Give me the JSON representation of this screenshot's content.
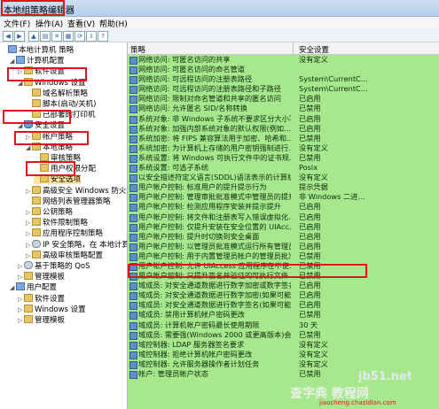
{
  "window": {
    "title": "本地组策略编辑器"
  },
  "menu": [
    "文件(F)",
    "操作(A)",
    "查看(V)",
    "帮助(H)"
  ],
  "tree": [
    {
      "label": "本地计算机 策略",
      "indent": 0,
      "icon": "pc"
    },
    {
      "label": "计算机配置",
      "indent": 1,
      "icon": "pc",
      "tw": "◢"
    },
    {
      "label": "软件设置",
      "indent": 2,
      "icon": "folder",
      "tw": "▷"
    },
    {
      "label": "Windows 设置",
      "indent": 2,
      "icon": "folder",
      "tw": "◢"
    },
    {
      "label": "域名解析策略",
      "indent": 3,
      "icon": "folder"
    },
    {
      "label": "脚本(启动/关机)",
      "indent": 3,
      "icon": "folder"
    },
    {
      "label": "已部署的打印机",
      "indent": 3,
      "icon": "folder"
    },
    {
      "label": "安全设置",
      "indent": 2,
      "icon": "shield",
      "tw": "◢"
    },
    {
      "label": "帐户策略",
      "indent": 3,
      "icon": "folder",
      "tw": "▷"
    },
    {
      "label": "本地策略",
      "indent": 3,
      "icon": "folder",
      "tw": "◢"
    },
    {
      "label": "审核策略",
      "indent": 4,
      "icon": "folder"
    },
    {
      "label": "用户权限分配",
      "indent": 4,
      "icon": "folder"
    },
    {
      "label": "安全选项",
      "indent": 4,
      "icon": "folder",
      "selected": true
    },
    {
      "label": "高级安全 Windows 防火墙",
      "indent": 3,
      "icon": "folder",
      "tw": "▷"
    },
    {
      "label": "网络列表管理器策略",
      "indent": 3,
      "icon": "folder"
    },
    {
      "label": "公钥策略",
      "indent": 3,
      "icon": "folder",
      "tw": "▷"
    },
    {
      "label": "软件限制策略",
      "indent": 3,
      "icon": "folder",
      "tw": "▷"
    },
    {
      "label": "应用程序控制策略",
      "indent": 3,
      "icon": "folder",
      "tw": "▷"
    },
    {
      "label": "IP 安全策略，在 本地计算机",
      "indent": 3,
      "icon": "gear",
      "tw": "▷"
    },
    {
      "label": "高级审核策略配置",
      "indent": 3,
      "icon": "folder",
      "tw": "▷"
    },
    {
      "label": "基于策略的 QoS",
      "indent": 2,
      "icon": "gear",
      "tw": "▷"
    },
    {
      "label": "管理模板",
      "indent": 2,
      "icon": "folder",
      "tw": "▷"
    },
    {
      "label": "用户配置",
      "indent": 1,
      "icon": "pc",
      "tw": "◢"
    },
    {
      "label": "软件设置",
      "indent": 2,
      "icon": "folder",
      "tw": "▷"
    },
    {
      "label": "Windows 设置",
      "indent": 2,
      "icon": "folder",
      "tw": "▷"
    },
    {
      "label": "管理模板",
      "indent": 2,
      "icon": "folder",
      "tw": "▷"
    }
  ],
  "columns": {
    "policy": "策略",
    "setting": "安全设置"
  },
  "policies": [
    {
      "name": "网络访问: 可匿名访问的共享",
      "value": "没有定义"
    },
    {
      "name": "网络访问: 可匿名访问的命名管道",
      "value": ""
    },
    {
      "name": "网络访问: 可远程访问的注册表路径",
      "value": "System\\CurrentC..."
    },
    {
      "name": "网络访问: 可远程访问的注册表路径和子路径",
      "value": "System\\CurrentC..."
    },
    {
      "name": "网络访问: 限制对命名管道和共享的匿名访问",
      "value": "已启用"
    },
    {
      "name": "网络访问: 允许匿名 SID/名称转换",
      "value": "已禁用"
    },
    {
      "name": "系统对象: 非 Windows 子系统不要求区分大小写",
      "value": "已启用"
    },
    {
      "name": "系统对象: 加强内部系统对象的默认权限(例如...)",
      "value": "已启用"
    },
    {
      "name": "系统加密: 将 FIPS 兼容算法用于加密、哈希和...",
      "value": "已禁用"
    },
    {
      "name": "系统加密: 为计算机上存储的用户密钥强制进行...",
      "value": "没有定义"
    },
    {
      "name": "系统设置: 将 Windows 可执行文件中的证书规...",
      "value": "已禁用"
    },
    {
      "name": "系统设置: 可选子系统",
      "value": "Posix"
    },
    {
      "name": "以安全描述符定义语言(SDDL)语法表示的计算机...",
      "value": "没有定义"
    },
    {
      "name": "用户帐户控制: 标准用户的提升提示行为",
      "value": "提示凭据"
    },
    {
      "name": "用户帐户控制: 管理审批批准模式中管理员的提升...",
      "value": "非 Windows 二进..."
    },
    {
      "name": "用户帐户控制: 检测应用程序安装并提示提升",
      "value": "已启用"
    },
    {
      "name": "用户帐户控制: 将文件和注册表写入错误虚拟化...",
      "value": "已启用"
    },
    {
      "name": "用户帐户控制: 仅提升安装在安全位置的 UIAcc...",
      "value": "已启用"
    },
    {
      "name": "用户帐户控制: 提升时切换到安全桌面",
      "value": "已启用"
    },
    {
      "name": "用户帐户控制: 以管理员批准模式运行所有管理员",
      "value": "已启用"
    },
    {
      "name": "用户帐户控制: 用于内置管理员帐户的管理员批准...",
      "value": "已禁用"
    },
    {
      "name": "用户帐户控制: 允许 UIAccess 应用程序在不使...",
      "value": "已禁用"
    },
    {
      "name": "用户帐户控制: 只提升签名并验证的可执行文件",
      "value": "已禁用"
    },
    {
      "name": "域成员: 对安全通道数据进行数字加密或数字签名...",
      "value": "已启用"
    },
    {
      "name": "域成员: 对安全通道数据进行数字加密(如果可能)",
      "value": "已启用"
    },
    {
      "name": "域成员: 对安全通道数据进行数字签名(如果可能)",
      "value": "已启用"
    },
    {
      "name": "域成员: 禁用计算机帐户密码更改",
      "value": "已禁用"
    },
    {
      "name": "域成员: 计算机帐户密码最长使用期限",
      "value": "30 天"
    },
    {
      "name": "域成员: 需要强(Windows 2000 或更高版本)会话...",
      "value": "已禁用"
    },
    {
      "name": "域控制器: LDAP 服务器签名要求",
      "value": "没有定义"
    },
    {
      "name": "域控制器: 拒绝计算机帐户密码更改",
      "value": "没有定义"
    },
    {
      "name": "域控制器: 允许服务器操作者计划任务",
      "value": "没有定义"
    },
    {
      "name": "帐户: 管理员帐户状态",
      "value": "已禁用"
    }
  ],
  "watermark": {
    "line1": "jb51.net",
    "line2": "查字典 教程网",
    "line3": "jiaocheng.chazidian.com"
  }
}
